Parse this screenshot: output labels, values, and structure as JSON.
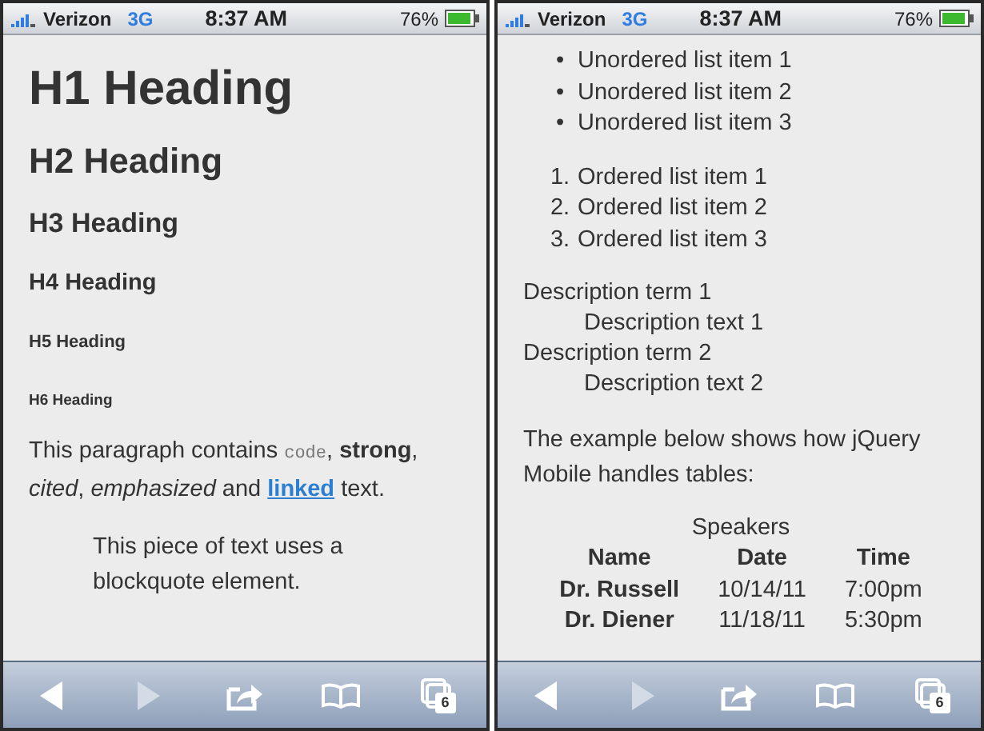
{
  "phones": [
    {
      "status": {
        "carrier": "Verizon",
        "network": "3G",
        "time": "8:37 AM",
        "battery": "76%"
      },
      "content": [
        {
          "kind": "h1",
          "text": "H1 Heading"
        },
        {
          "kind": "h2",
          "text": "H2 Heading"
        },
        {
          "kind": "h3",
          "text": "H3 Heading"
        },
        {
          "kind": "h4",
          "text": "H4 Heading"
        },
        {
          "kind": "h5",
          "text": "H5 Heading"
        },
        {
          "kind": "h6",
          "text": "H6 Heading"
        },
        {
          "kind": "paragraph",
          "segments": [
            {
              "kind": "text",
              "text": "This paragraph contains "
            },
            {
              "kind": "code",
              "text": "code"
            },
            {
              "kind": "text",
              "text": ", "
            },
            {
              "kind": "strong",
              "text": "strong"
            },
            {
              "kind": "text",
              "text": ", "
            },
            {
              "kind": "cite",
              "text": "cited"
            },
            {
              "kind": "text",
              "text": ", "
            },
            {
              "kind": "em",
              "text": "emphasized"
            },
            {
              "kind": "text",
              "text": " and "
            },
            {
              "kind": "link",
              "text": "linked"
            },
            {
              "kind": "text",
              "text": " text."
            }
          ]
        },
        {
          "kind": "blockquote",
          "text": "This piece of text uses a blockquote element."
        }
      ],
      "toolbar": {
        "back_disabled": false,
        "forward_disabled": true,
        "tab_count": "6"
      }
    },
    {
      "status": {
        "carrier": "Verizon",
        "network": "3G",
        "time": "8:37 AM",
        "battery": "76%"
      },
      "content": [
        {
          "kind": "list",
          "items": [
            {
              "marker": "•",
              "text": "Unordered list item 1"
            },
            {
              "marker": "•",
              "text": "Unordered list item 2"
            },
            {
              "marker": "•",
              "text": "Unordered list item 3"
            }
          ]
        },
        {
          "kind": "list",
          "items": [
            {
              "marker": "1.",
              "text": "Ordered list item 1"
            },
            {
              "marker": "2.",
              "text": "Ordered list item 2"
            },
            {
              "marker": "3.",
              "text": "Ordered list item 3"
            }
          ]
        },
        {
          "kind": "description",
          "entries": [
            {
              "term": "Description term 1",
              "text": "Description text 1"
            },
            {
              "term": "Description term 2",
              "text": "Description text 2"
            }
          ]
        },
        {
          "kind": "paragraph",
          "segments": [
            {
              "kind": "text",
              "text": "The example below shows how jQuery Mobile handles tables:"
            }
          ]
        },
        {
          "kind": "table",
          "caption": "Speakers",
          "columns": [
            "Name",
            "Date",
            "Time"
          ],
          "rows": [
            [
              "Dr. Russell",
              "10/14/11",
              "7:00pm"
            ],
            [
              "Dr. Diener",
              "11/18/11",
              "5:30pm"
            ]
          ]
        }
      ],
      "toolbar": {
        "back_disabled": false,
        "forward_disabled": true,
        "tab_count": "6"
      }
    }
  ]
}
